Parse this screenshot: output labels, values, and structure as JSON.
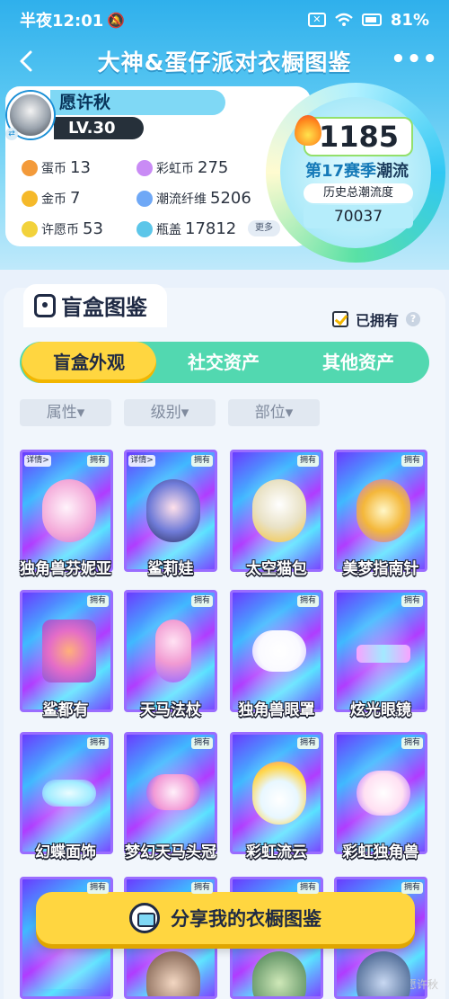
{
  "status_bar": {
    "time": "半夜12:01",
    "battery": "81%",
    "colors": {
      "text": "#ffffff"
    }
  },
  "header": {
    "title": "大神&蛋仔派对衣橱图鉴",
    "back_icon": "back-arrow-icon",
    "more_icon": "more-dots-icon"
  },
  "profile": {
    "name": "愿许秋",
    "level": "LV.30",
    "currencies": [
      {
        "label": "蛋币",
        "value": "13",
        "color": "#f39a3a"
      },
      {
        "label": "彩虹币",
        "value": "275",
        "color": "#c98bf5"
      },
      {
        "label": "金币",
        "value": "7",
        "color": "#f5b92a"
      },
      {
        "label": "潮流纤维",
        "value": "5206",
        "color": "#6fa8f6"
      },
      {
        "label": "许愿币",
        "value": "53",
        "color": "#f2d23b"
      },
      {
        "label": "瓶盖",
        "value": "17812",
        "color": "#5cc6e9"
      }
    ],
    "more": "更多"
  },
  "season": {
    "score": "1185",
    "season_label": "第17赛季",
    "season_suffix": "潮流",
    "history_label": "历史总潮流度",
    "history_value": "70037"
  },
  "section": {
    "title": "盲盒图鉴",
    "owned_filter": "已拥有",
    "owned_checked": true
  },
  "tabs": [
    {
      "label": "盲盒外观",
      "active": true
    },
    {
      "label": "社交资产",
      "active": false
    },
    {
      "label": "其他资产",
      "active": false
    }
  ],
  "filters": [
    "属性▾",
    "级别▾",
    "部位▾"
  ],
  "items": [
    {
      "name": "独角兽芬妮亚",
      "owned": "拥有",
      "detail": "详情>"
    },
    {
      "name": "鲨莉娃",
      "owned": "拥有",
      "detail": "详情>"
    },
    {
      "name": "太空猫包",
      "owned": "拥有",
      "detail": ""
    },
    {
      "name": "美梦指南针",
      "owned": "拥有",
      "detail": ""
    },
    {
      "name": "鲨都有",
      "owned": "拥有",
      "detail": ""
    },
    {
      "name": "天马法杖",
      "owned": "拥有",
      "detail": ""
    },
    {
      "name": "独角兽眼罩",
      "owned": "拥有",
      "detail": ""
    },
    {
      "name": "炫光眼镜",
      "owned": "拥有",
      "detail": ""
    },
    {
      "name": "幻蝶面饰",
      "owned": "拥有",
      "detail": ""
    },
    {
      "name": "梦幻天马头冠",
      "owned": "拥有",
      "detail": ""
    },
    {
      "name": "彩虹流云",
      "owned": "拥有",
      "detail": ""
    },
    {
      "name": "彩虹独角兽",
      "owned": "拥有",
      "detail": ""
    },
    {
      "name": "",
      "owned": "拥有",
      "detail": ""
    },
    {
      "name": "",
      "owned": "拥有",
      "detail": ""
    },
    {
      "name": "",
      "owned": "拥有",
      "detail": ""
    },
    {
      "name": "",
      "owned": "拥有",
      "detail": ""
    }
  ],
  "share_button": {
    "label": "分享我的衣橱图鉴"
  },
  "watermark": "@愿许秋",
  "colors": {
    "accent_yellow": "#ffd640",
    "tab_green": "#52d8b0",
    "header_blue": "#2fb0ec"
  }
}
